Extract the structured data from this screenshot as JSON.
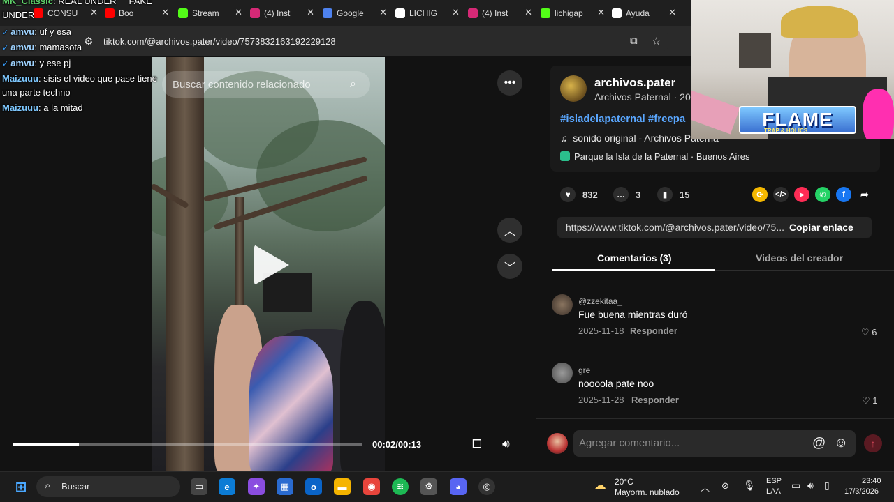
{
  "browser": {
    "tabs": [
      {
        "label": "CONSU",
        "icon": "youtube-icon",
        "color": "#ff0000"
      },
      {
        "label": "Boo",
        "icon": "youtube-icon",
        "color": "#ff0000"
      },
      {
        "label": "Stream",
        "icon": "kick-icon",
        "color": "#53fc18"
      },
      {
        "label": "(4) Inst",
        "icon": "instagram-icon",
        "color": "#d62976"
      },
      {
        "label": "Google",
        "icon": "gemini-icon",
        "color": "#4e82ee"
      },
      {
        "label": "LICHIG",
        "icon": "google-icon",
        "color": "#ffffff"
      },
      {
        "label": "(4) Inst",
        "icon": "instagram-icon",
        "color": "#d62976"
      },
      {
        "label": "lichigap",
        "icon": "kick-icon",
        "color": "#53fc18"
      },
      {
        "label": "Ayuda",
        "icon": "google-icon",
        "color": "#ffffff"
      }
    ],
    "url": "tiktok.com/@archivos.pater/video/7573832163192229128"
  },
  "chat": [
    {
      "user": "MK_Classic",
      "text": ": REAL UNDER",
      "suffix": "FAKE"
    },
    {
      "user": "",
      "text": "UNDER",
      "suffix": ""
    },
    {
      "user": "amvu",
      "text": ": uf y esa",
      "suffix": ""
    },
    {
      "user": "amvu",
      "text": ": mamasota",
      "suffix": ""
    },
    {
      "user": "amvu",
      "text": ": y ese pj",
      "suffix": ""
    },
    {
      "user": "Maizuuu",
      "text": ": sisis el video que pase tiene",
      "suffix": ""
    },
    {
      "user": "",
      "text": "una parte techno",
      "suffix": ""
    },
    {
      "user": "Maizuuu",
      "text": ": a la mitad",
      "suffix": ""
    }
  ],
  "video": {
    "search_placeholder": "Buscar contenido relacionado",
    "time": "00:02/00:13",
    "progress": 0.19
  },
  "post": {
    "username": "archivos.pater",
    "nickname": "Archivos Paternal · 202",
    "hashtags": "#isladelapaternal #freepa",
    "sound": "sonido original - Archivos Paterna",
    "location": "Parque la Isla de la Paternal · Buenos Aires",
    "likes": "832",
    "comments": "3",
    "saves": "15",
    "link": "https://www.tiktok.com/@archivos.pater/video/75...",
    "copy_label": "Copiar enlace"
  },
  "tabs2": {
    "comments": "Comentarios (3)",
    "creator": "Videos del creador"
  },
  "comments": [
    {
      "user": "@zzekitaa_",
      "text": "Fue buena mientras duró",
      "date": "2025-11-18",
      "reply": "Responder",
      "likes": "6"
    },
    {
      "user": "gre",
      "text": "noooola pate noo",
      "date": "2025-11-28",
      "reply": "Responder",
      "likes": "1"
    }
  ],
  "compose": {
    "placeholder": "Agregar comentario..."
  },
  "overlay": {
    "brand": "FLAME",
    "brand_sub": "TRAP & HOLICS"
  },
  "taskbar": {
    "search": "Buscar",
    "weather_temp": "20°C",
    "weather_desc": "Mayorm. nublado",
    "lang1": "ESP",
    "lang2": "LAA",
    "time": "23:40",
    "date": "17/3/2026"
  }
}
